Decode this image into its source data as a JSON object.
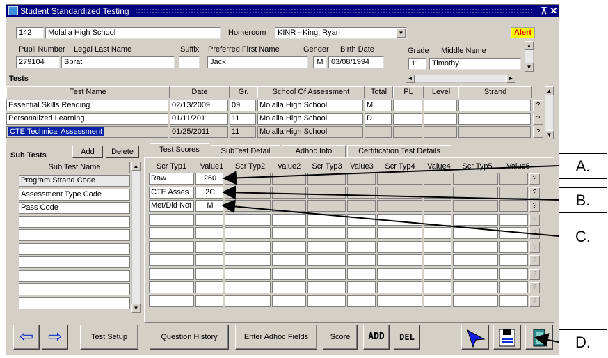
{
  "window": {
    "title": "Student Standardized Testing",
    "restore_label": "̅↗",
    "close_label": "✕"
  },
  "school": {
    "id": "142",
    "name": "Molalla High School"
  },
  "homeroom": {
    "label": "Homeroom",
    "value": "KINR - King, Ryan"
  },
  "alert_label": "Alert",
  "pupil": {
    "labels": {
      "pupil_number": "Pupil Number",
      "last_name": "Legal Last Name",
      "suffix": "Suffix",
      "first_name": "Preferred First Name",
      "gender": "Gender",
      "birth_date": "Birth Date",
      "grade": "Grade",
      "middle_name": "Middle Name"
    },
    "pupil_number": "279104",
    "last_name": "Sprat",
    "suffix": "",
    "first_name": "Jack",
    "gender": "M",
    "birth_date": "03/08/1994",
    "grade": "11",
    "middle_name": "Timothy"
  },
  "tests": {
    "section_label": "Tests",
    "headers": [
      "Test Name",
      "Date",
      "Gr.",
      "School Of Assessment",
      "Total",
      "PL",
      "Level",
      "Strand"
    ],
    "rows": [
      {
        "name": "Essential Skills Reading",
        "date": "02/13/2009",
        "grade": "09",
        "school": "Molalla High School",
        "total": "M",
        "pl": "",
        "level": "",
        "strand": ""
      },
      {
        "name": "Personalized Learning",
        "date": "01/11/2011",
        "grade": "11",
        "school": "Molalla High School",
        "total": "D",
        "pl": "",
        "level": "",
        "strand": ""
      },
      {
        "name": "CTE Technical Assessment",
        "date": "01/25/2011",
        "grade": "11",
        "school": "Molalla High School",
        "total": "",
        "pl": "",
        "level": "",
        "strand": ""
      }
    ],
    "q": "?"
  },
  "subtests": {
    "section_label": "Sub Tests",
    "add_label": "Add",
    "delete_label": "Delete",
    "header": "Sub Test Name",
    "rows": [
      "Program Strand Code",
      "Assessment Type Code",
      "Pass Code",
      "",
      "",
      "",
      "",
      "",
      "",
      ""
    ]
  },
  "tabs": [
    "Test Scores",
    "SubTest Detail",
    "Adhoc Info",
    "Certification Test Details"
  ],
  "scores": {
    "headers": [
      "Scr Typ1",
      "Value1",
      "Scr Typ2",
      "Value2",
      "Scr Typ3",
      "Value3",
      "Scr Typ4",
      "Value4",
      "Scr Typ5",
      "Value5"
    ],
    "rows": [
      [
        "Raw",
        "260"
      ],
      [
        "CTE Asses",
        "2C"
      ],
      [
        "Met/Did Not",
        "M"
      ]
    ]
  },
  "toolbar": {
    "test_setup": "Test Setup",
    "question_history": "Question History",
    "enter_adhoc": "Enter Adhoc Fields",
    "score": "Score",
    "add": "ADD",
    "del": "DEL"
  },
  "callouts": [
    "A.",
    "B.",
    "C.",
    "D."
  ]
}
